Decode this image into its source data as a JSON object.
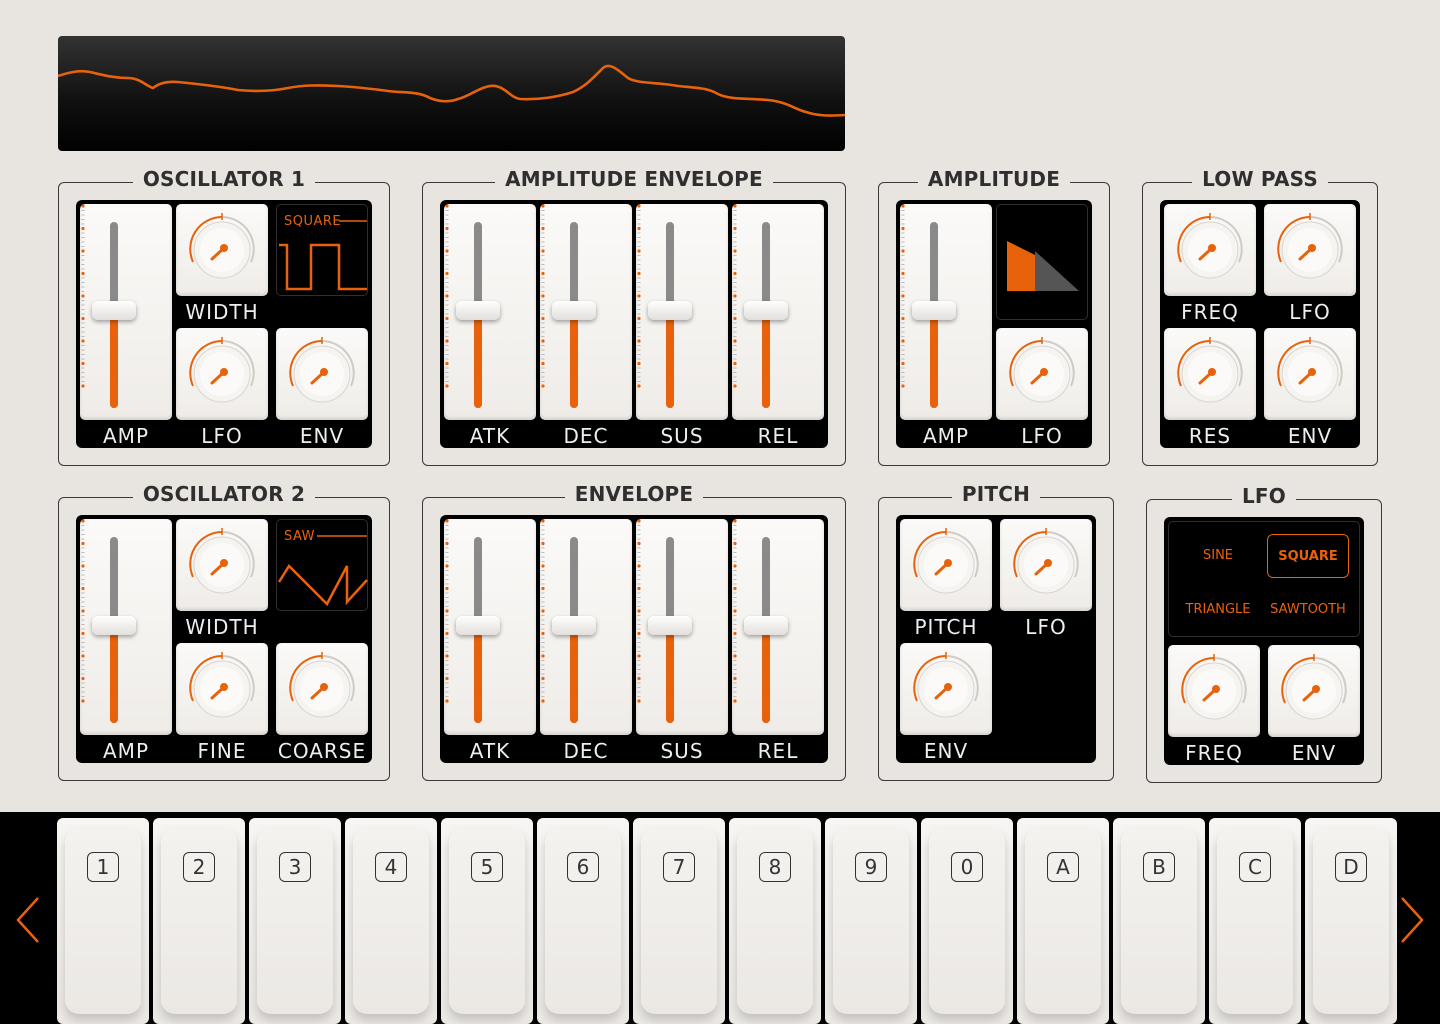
{
  "colors": {
    "accent": "#e8620c",
    "background": "#e8e4df",
    "panel": "#000000"
  },
  "oscilloscope": {
    "name": "waveform-display"
  },
  "osc1": {
    "title": "OSCILLATOR 1",
    "amp": "AMP",
    "width": "WIDTH",
    "lfo": "LFO",
    "env": "ENV",
    "wave": "SQUARE",
    "amp_level": 0.52
  },
  "osc2": {
    "title": "OSCILLATOR 2",
    "amp": "AMP",
    "width": "WIDTH",
    "fine": "FINE",
    "coarse": "COARSE",
    "wave": "SAW",
    "amp_level": 0.52
  },
  "ampenv": {
    "title": "AMPLITUDE ENVELOPE",
    "atk": "ATK",
    "dec": "DEC",
    "sus": "SUS",
    "rel": "REL",
    "levels": [
      0.52,
      0.52,
      0.52,
      0.52
    ]
  },
  "env": {
    "title": "ENVELOPE",
    "atk": "ATK",
    "dec": "DEC",
    "sus": "SUS",
    "rel": "REL",
    "levels": [
      0.52,
      0.52,
      0.52,
      0.52
    ]
  },
  "amplitude": {
    "title": "AMPLITUDE",
    "amp": "AMP",
    "lfo": "LFO",
    "amp_level": 0.52
  },
  "lowpass": {
    "title": "LOW PASS",
    "freq": "FREQ",
    "lfo": "LFO",
    "res": "RES",
    "env": "ENV"
  },
  "pitch": {
    "title": "PITCH",
    "pitch": "PITCH",
    "lfo": "LFO",
    "env": "ENV"
  },
  "lfo": {
    "title": "LFO",
    "sine": "SINE",
    "square": "SQUARE",
    "triangle": "TRIANGLE",
    "sawtooth": "SAWTOOTH",
    "selected": "SQUARE",
    "freq": "FREQ",
    "env": "ENV"
  },
  "keys": [
    "1",
    "2",
    "3",
    "4",
    "5",
    "6",
    "7",
    "8",
    "9",
    "0",
    "A",
    "B",
    "C",
    "D"
  ],
  "nav": {
    "prev": "prev-arrow-icon",
    "next": "next-arrow-icon"
  }
}
